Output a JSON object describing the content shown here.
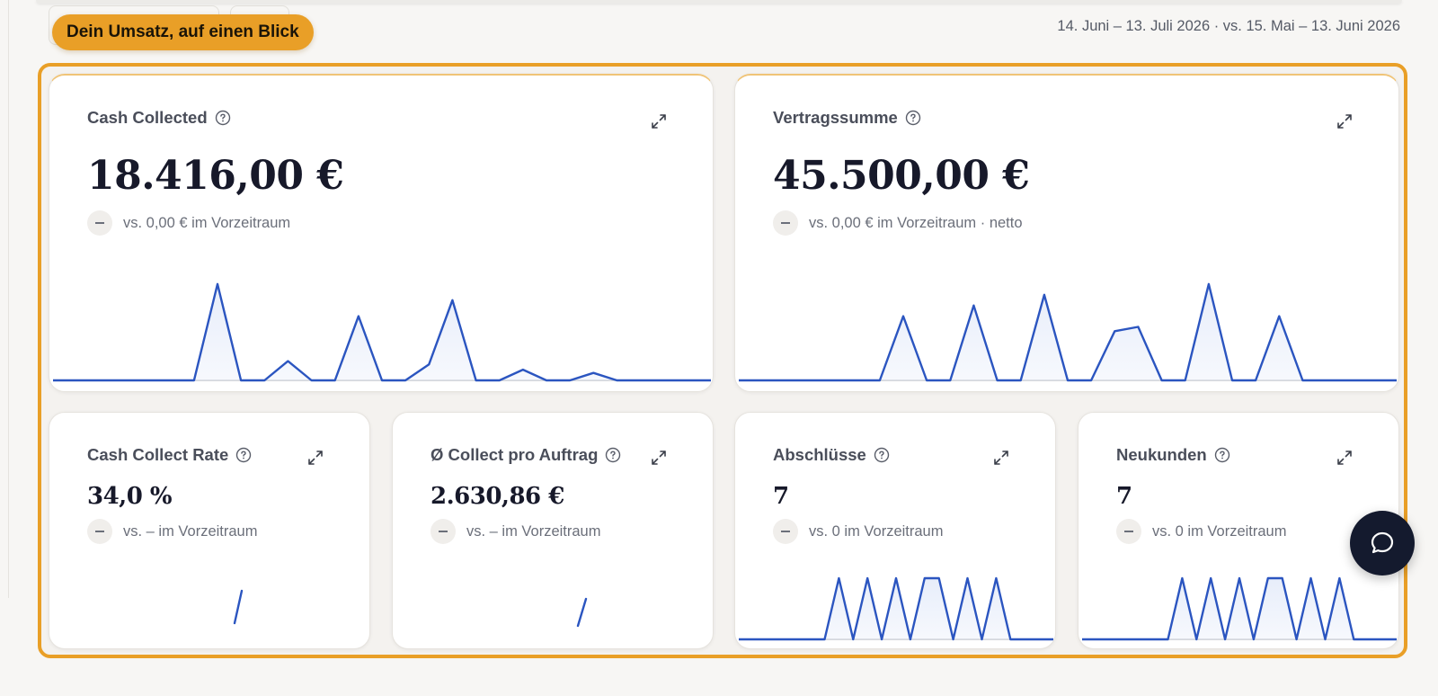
{
  "header": {
    "badge": "Dein Umsatz, auf einen Blick",
    "date_range": "14. Juni – 13. Juli 2026 · vs. 15. Mai – 13. Juni 2026"
  },
  "colors": {
    "accent": "#e99f27",
    "line": "#2b55c0",
    "fill": "#e7edfa"
  },
  "cards": {
    "cash_collected": {
      "title": "Cash Collected",
      "value": "18.416,00 €",
      "compare": "vs. 0,00 € im Vorzeitraum",
      "spark": [
        0,
        0,
        0,
        0,
        0,
        0,
        0,
        0.9,
        0,
        0,
        0.18,
        0,
        0,
        0.6,
        0,
        0,
        0.15,
        0.75,
        0,
        0,
        0.1,
        0,
        0,
        0.07,
        0,
        0,
        0,
        0,
        0
      ]
    },
    "vertragssumme": {
      "title": "Vertragssumme",
      "value": "45.500,00 €",
      "compare": "vs. 0,00 € im Vorzeitraum · netto",
      "spark": [
        0,
        0,
        0,
        0,
        0,
        0,
        0,
        0.6,
        0,
        0,
        0.7,
        0,
        0,
        0.8,
        0,
        0,
        0.46,
        0.5,
        0,
        0,
        0.9,
        0,
        0,
        0.6,
        0,
        0,
        0,
        0,
        0
      ]
    },
    "cash_collect_rate": {
      "title": "Cash Collect Rate",
      "value": "34,0 %",
      "compare": "vs. – im Vorzeitraum"
    },
    "collect_pro_auftrag": {
      "title": "Ø Collect pro Auftrag",
      "value": "2.630,86 €",
      "compare": "vs. – im Vorzeitraum"
    },
    "abschluesse": {
      "title": "Abschlüsse",
      "value": "7",
      "compare": "vs. 0 im Vorzeitraum",
      "spark": [
        0,
        0,
        0,
        0,
        0,
        0,
        0,
        1,
        0,
        1,
        0,
        1,
        0,
        1,
        1,
        0,
        1,
        0,
        1,
        0,
        0,
        0,
        0
      ]
    },
    "neukunden": {
      "title": "Neukunden",
      "value": "7",
      "compare": "vs. 0 im Vorzeitraum",
      "spark": [
        0,
        0,
        0,
        0,
        0,
        0,
        0,
        1,
        0,
        1,
        0,
        1,
        0,
        1,
        1,
        0,
        1,
        0,
        1,
        0,
        0,
        0,
        0
      ]
    }
  },
  "icons": {
    "help": "help-circle-icon",
    "expand": "expand-icon",
    "chat": "chat-bubble-icon"
  }
}
